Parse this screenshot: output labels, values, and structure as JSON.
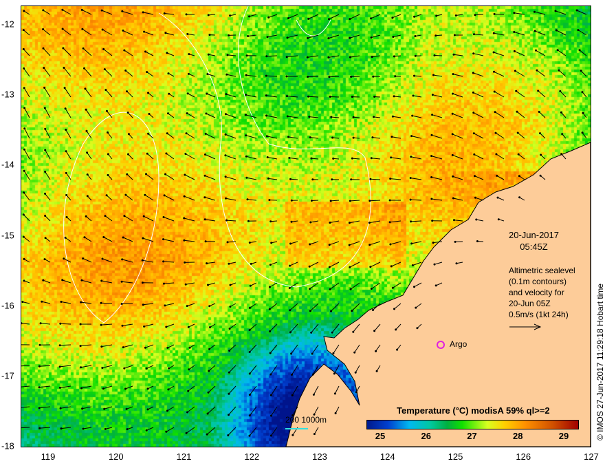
{
  "map": {
    "x_ticks": [
      "119",
      "120",
      "121",
      "122",
      "123",
      "124",
      "125",
      "126",
      "127"
    ],
    "y_ticks": [
      "-12",
      "-13",
      "-14",
      "-15",
      "-16",
      "-17",
      "-18"
    ],
    "date": "20-Jun-2017",
    "time": "05:45Z",
    "description": [
      "Altimetric sealevel",
      "(0.1m contours)",
      "and velocity for",
      "20-Jun 05Z",
      "0.5m/s (1kt 24h)"
    ],
    "argo_label": "Argo",
    "scale_label": "200  1000m",
    "copyright": "© IMOS 27-Jun-2017 11:29:18 Hobart time"
  },
  "colorbar": {
    "title": "Temperature (°C) modisA 59% ql>=2",
    "ticks": [
      "25",
      "26",
      "27",
      "28",
      "29"
    ],
    "min": 24.7,
    "max": 29.3
  },
  "colors": {
    "land": "#fdcc99",
    "argo": "#e020e0",
    "contour": "#ffffff",
    "bathy": "#30e0e0"
  }
}
